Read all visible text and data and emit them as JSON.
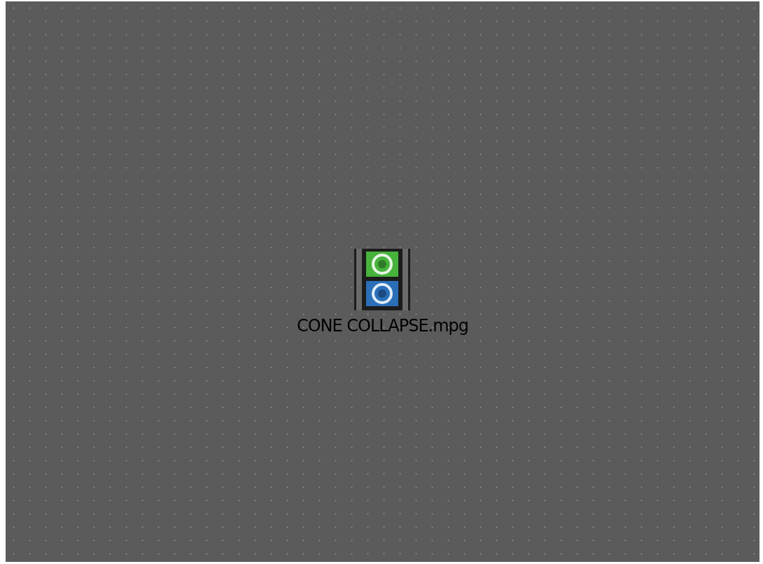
{
  "desktop": {
    "icons": [
      {
        "label": "CONE COLLAPSE.mpg"
      }
    ]
  }
}
